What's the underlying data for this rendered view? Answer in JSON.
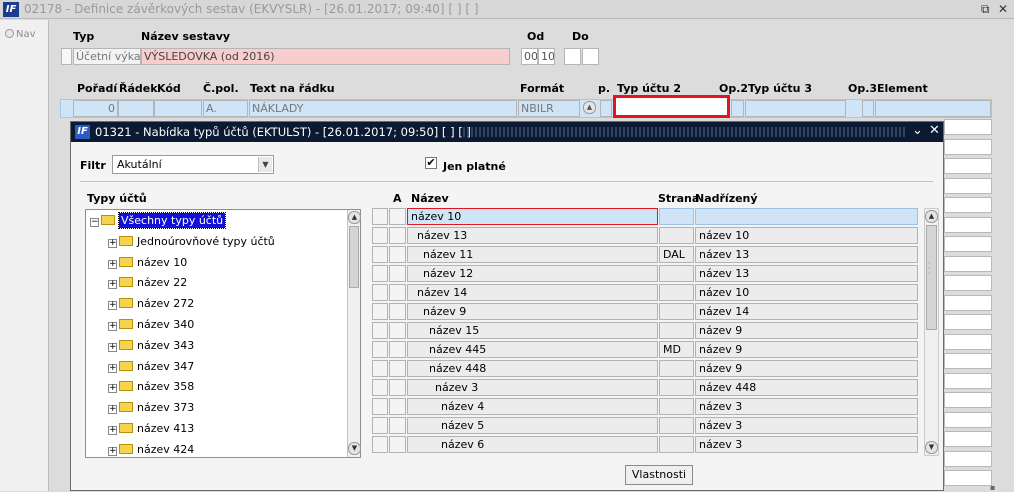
{
  "window": {
    "title": "02178 - Definice závěrkových sestav (EKVYSLR) - [26.01.2017; 09:40]  [ ]  [ ]",
    "logo": "IF",
    "restore_icon": "⧉",
    "close_icon": "✕"
  },
  "nav": {
    "label": "Nav"
  },
  "header": {
    "typ_label": "Typ",
    "nazev_label": "Název sestavy",
    "od_label": "Od",
    "do_label": "Do",
    "typ_value": "Účetní výkaz",
    "nazev_value": "VÝSLEDOVKA (od 2016)",
    "od_value1": "00",
    "od_value2": "10"
  },
  "columns": {
    "poradi": "Pořadí",
    "radek": "Řádek",
    "kod": "Kód",
    "cpol": "Č.pol.",
    "text": "Text na řádku",
    "format": "Formát",
    "op": "p.",
    "typ2": "Typ účtu 2",
    "op2": "Op.2",
    "typ3": "Typ účtu 3",
    "op3": "Op.3",
    "element": "Element"
  },
  "first_row": {
    "poradi": "0",
    "cpol": "A.",
    "text": "NÁKLADY",
    "format": "NBILR"
  },
  "popup": {
    "title": "01321 - Nabídka typů účtů (EKTULST) - [26.01.2017; 09:50]  [ ]  [ ]",
    "logo": "IF",
    "filtr_label": "Filtr",
    "filtr_value": "Akutální",
    "jen_platne_label": "Jen platné",
    "jen_platne_checked": true,
    "tree_header": "Typy účtů",
    "tree": [
      {
        "label": "Všechny typy účtů",
        "level": 0,
        "selected": true
      },
      {
        "label": "Jednoúrovňové typy účtů",
        "level": 1
      },
      {
        "label": "název 10",
        "level": 1
      },
      {
        "label": "název 22",
        "level": 1
      },
      {
        "label": "název 272",
        "level": 1
      },
      {
        "label": "název 340",
        "level": 1
      },
      {
        "label": "název 343",
        "level": 1
      },
      {
        "label": "název 347",
        "level": 1
      },
      {
        "label": "název 358",
        "level": 1
      },
      {
        "label": "název 373",
        "level": 1
      },
      {
        "label": "název 413",
        "level": 1
      },
      {
        "label": "název 424",
        "level": 1
      }
    ],
    "grid_headers": {
      "a": "A",
      "nazev": "Název",
      "strana": "Strana",
      "nadrizeny": "Nadřízený"
    },
    "grid_rows": [
      {
        "nazev": "název 10",
        "strana": "",
        "nadrizeny": "",
        "indent": 0
      },
      {
        "nazev": "název 13",
        "strana": "",
        "nadrizeny": "název 10",
        "indent": 1
      },
      {
        "nazev": "název 11",
        "strana": "DAL",
        "nadrizeny": "název 13",
        "indent": 2
      },
      {
        "nazev": "název 12",
        "strana": "",
        "nadrizeny": "název 13",
        "indent": 2
      },
      {
        "nazev": "název 14",
        "strana": "",
        "nadrizeny": "název 10",
        "indent": 1
      },
      {
        "nazev": "název 9",
        "strana": "",
        "nadrizeny": "název 14",
        "indent": 2
      },
      {
        "nazev": "název 15",
        "strana": "",
        "nadrizeny": "název 9",
        "indent": 3
      },
      {
        "nazev": "název 445",
        "strana": "MD",
        "nadrizeny": "název 9",
        "indent": 3
      },
      {
        "nazev": "název 448",
        "strana": "",
        "nadrizeny": "název 9",
        "indent": 3
      },
      {
        "nazev": "název 3",
        "strana": "",
        "nadrizeny": "název 448",
        "indent": 4
      },
      {
        "nazev": "název 4",
        "strana": "",
        "nadrizeny": "název 3",
        "indent": 5
      },
      {
        "nazev": "název 5",
        "strana": "",
        "nadrizeny": "název 3",
        "indent": 5
      },
      {
        "nazev": "název 6",
        "strana": "",
        "nadrizeny": "název 3",
        "indent": 5
      }
    ],
    "vlastnosti_label": "Vlastnosti"
  },
  "colors": {
    "popup_titlebar": "#0b1932",
    "highlight_border": "#e3141b",
    "selected_row": "#cfe5f7",
    "pink_field": "#f8cdcd",
    "tree_selected": "#1010d8"
  }
}
